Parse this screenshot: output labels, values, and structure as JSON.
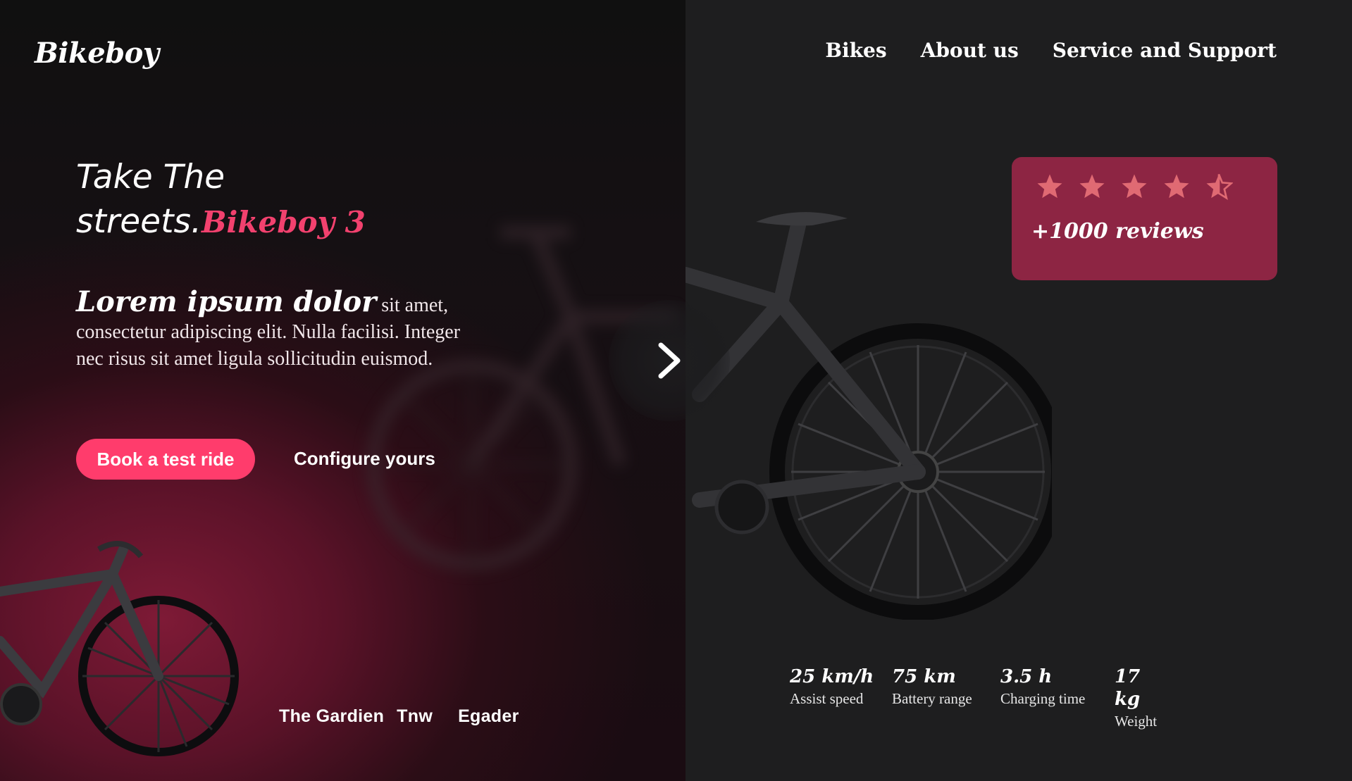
{
  "brand": {
    "name": "Bikeboy"
  },
  "nav": {
    "items": [
      "Bikes",
      "About us",
      "Service and Support"
    ]
  },
  "hero": {
    "headline_line1": "Take The",
    "headline_line2": "streets.",
    "headline_accent": "Bikeboy 3",
    "body_strong": "Lorem ipsum dolor",
    "body_text": " sit amet, consectetur adipiscing elit.  Nulla facilisi. Integer nec risus sit amet ligula sollicitudin euismod.",
    "primary_cta": "Book a test ride",
    "secondary_cta": "Configure yours"
  },
  "partners": [
    "The Gardien",
    "Tnw",
    "Egader"
  ],
  "rating": {
    "stars": 4.5,
    "reviews": "+1000 reviews",
    "star_color": "#e06a73",
    "card_color": "#8d2543"
  },
  "specs": [
    {
      "value": "25 km/h",
      "label": "Assist speed"
    },
    {
      "value": "75 km",
      "label": "Battery range"
    },
    {
      "value": "3.5 h",
      "label": "Charging time"
    },
    {
      "value": "17 kg",
      "label": "Weight"
    }
  ],
  "colors": {
    "accent": "#ff3c6c",
    "accent_text": "#f2416e"
  },
  "icons": {
    "next": "chevron-right-icon",
    "star": "star-icon"
  }
}
